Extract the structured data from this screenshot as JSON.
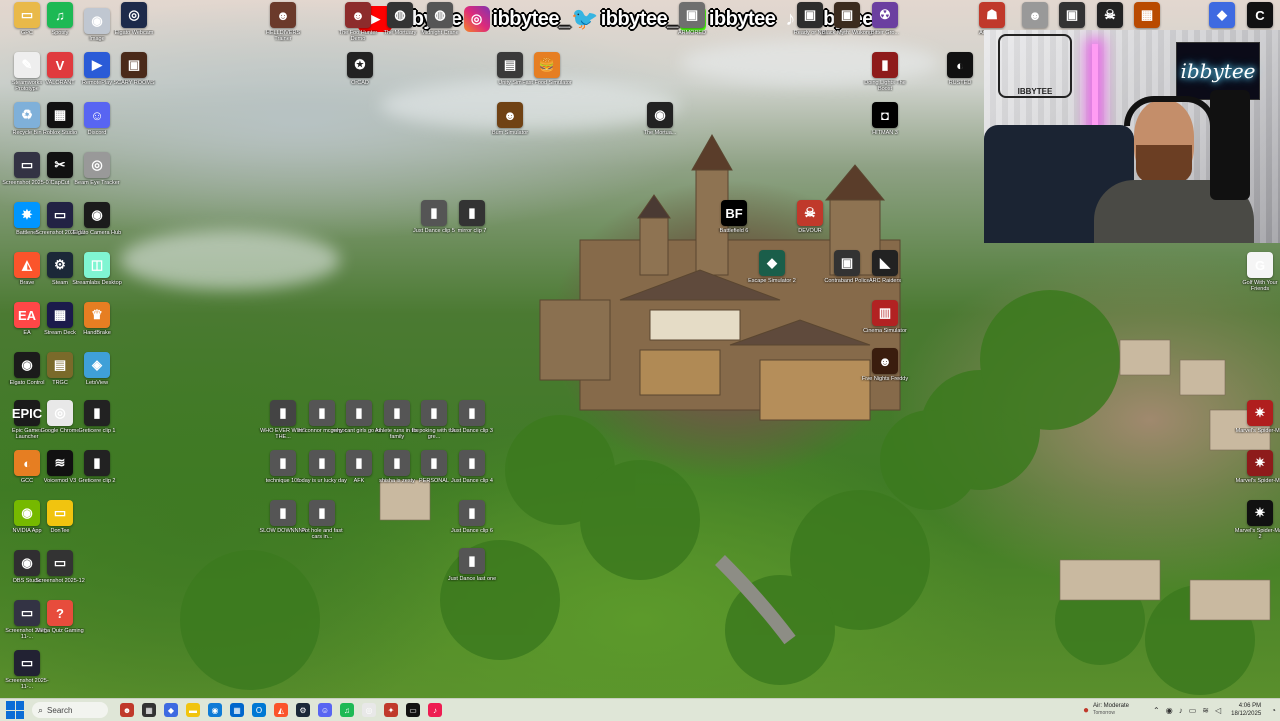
{
  "social": {
    "youtube": "ibbytee",
    "instagram": "ibbytee_",
    "twitter": "ibbytee_",
    "kick": "ibbytee",
    "tiktok": "ibbytee"
  },
  "webcam_overlay": {
    "logo_text": "ibbytee",
    "wall_sign": "IBBYTEE"
  },
  "taskbar": {
    "search_placeholder": "Search",
    "weather_text": "Air: Moderate",
    "weather_sub": "Tomorrow",
    "time": "4:06 PM",
    "date": "18/12/2025"
  },
  "icons": [
    {
      "label": "GPC",
      "color": "#e9b949",
      "glyph": "▭"
    },
    {
      "label": "Spotify",
      "color": "#1db954",
      "glyph": "♫"
    },
    {
      "label": "Image",
      "color": "#c0c7d1",
      "glyph": "◉"
    },
    {
      "label": "Elgato Webcam",
      "color": "#1d2a4a",
      "glyph": "◎"
    },
    {
      "label": "HELLDIVERS Trainer",
      "color": "#6b3a2b",
      "glyph": "☻"
    },
    {
      "label": "The Foo Hunter Demo",
      "color": "#8d2c2c",
      "glyph": "☻"
    },
    {
      "label": "The Mortuary",
      "color": "#333",
      "glyph": "◍"
    },
    {
      "label": "Midnight Crane",
      "color": "#555",
      "glyph": "◍"
    },
    {
      "label": "ARMORED",
      "color": "#6f6f6f",
      "glyph": "▣"
    },
    {
      "label": "Ready or Not",
      "color": "#2d2d2d",
      "glyph": "▣"
    },
    {
      "label": "Black Myth: Wukong",
      "color": "#3b2b1e",
      "glyph": "▣"
    },
    {
      "label": "Bitter Gro...",
      "color": "#6b3fa0",
      "glyph": "☢"
    },
    {
      "label": "Among Us",
      "color": "#c0392b",
      "glyph": "☗"
    },
    {
      "label": "Face",
      "color": "#999",
      "glyph": "☻"
    },
    {
      "label": "Game",
      "color": "#333",
      "glyph": "▣"
    },
    {
      "label": "Game",
      "color": "#222",
      "glyph": "☠"
    },
    {
      "label": "Game",
      "color": "#b94a00",
      "glyph": "▦"
    },
    {
      "label": "Copilot",
      "color": "#3e6ae1",
      "glyph": "◆"
    },
    {
      "label": "CALL OF DUTY",
      "color": "#111",
      "glyph": "C"
    },
    {
      "label": "Steamworks Prototype",
      "color": "#eee",
      "glyph": "✎"
    },
    {
      "label": "VALORANT",
      "color": "#e03a3e",
      "glyph": "V"
    },
    {
      "label": "RemotePlay",
      "color": "#2a5bd7",
      "glyph": "▶"
    },
    {
      "label": "SCARY ROOMS",
      "color": "#4a2a1a",
      "glyph": "▣"
    },
    {
      "label": "OrCAD",
      "color": "#222",
      "glyph": "✪"
    },
    {
      "label": "Unity Sim",
      "color": "#3a3a3a",
      "glyph": "▤"
    },
    {
      "label": "Fast Food Simulator",
      "color": "#e67e22",
      "glyph": "🍔"
    },
    {
      "label": "Doing Lights The Boost",
      "color": "#8e1b1b",
      "glyph": "▮"
    },
    {
      "label": "RUSTED",
      "color": "#111",
      "glyph": "◐"
    },
    {
      "label": "Recycle Bin",
      "color": "#7fb0d9",
      "glyph": "♻"
    },
    {
      "label": "Roblox Studio",
      "color": "#111",
      "glyph": "▦"
    },
    {
      "label": "Discord",
      "color": "#5865f2",
      "glyph": "☺"
    },
    {
      "label": "Bum Simulator",
      "color": "#704214",
      "glyph": "☻"
    },
    {
      "label": "The Mortua...",
      "color": "#222",
      "glyph": "◉"
    },
    {
      "label": "HITMAN 3",
      "color": "#000",
      "glyph": "◘"
    },
    {
      "label": "Screenshot 2025-07",
      "color": "#334",
      "glyph": "▭"
    },
    {
      "label": "CapCut",
      "color": "#111",
      "glyph": "✂"
    },
    {
      "label": "Beam Eye Tracker",
      "color": "#999",
      "glyph": "◎"
    },
    {
      "label": "Battlenet",
      "color": "#0096ff",
      "glyph": "✸"
    },
    {
      "label": "Screenshot 2025-11",
      "color": "#224",
      "glyph": "▭"
    },
    {
      "label": "Elgato Camera Hub",
      "color": "#1b1b1b",
      "glyph": "◉"
    },
    {
      "label": "Just Dance clip 5",
      "color": "#555",
      "glyph": "▮"
    },
    {
      "label": "mirror clip 7",
      "color": "#333",
      "glyph": "▮"
    },
    {
      "label": "Battlefield 6",
      "color": "#000",
      "glyph": "BF"
    },
    {
      "label": "DEVOUR",
      "color": "#c0392b",
      "glyph": "☠"
    },
    {
      "label": "Escape Simulator 2",
      "color": "#1a5e4a",
      "glyph": "◆"
    },
    {
      "label": "Contraband Police",
      "color": "#333",
      "glyph": "▣"
    },
    {
      "label": "ARC Raiders",
      "color": "#222",
      "glyph": "◣"
    },
    {
      "label": "Brave",
      "color": "#fb542b",
      "glyph": "◭"
    },
    {
      "label": "Steam",
      "color": "#1b2838",
      "glyph": "⚙"
    },
    {
      "label": "Streamlabs Desktop",
      "color": "#80f5d2",
      "glyph": "◫"
    },
    {
      "label": "Cinema Simulator",
      "color": "#b22222",
      "glyph": "▥"
    },
    {
      "label": "Golf With Your Friends",
      "color": "#f5f5f5",
      "glyph": "G"
    },
    {
      "label": "EA",
      "color": "#ff4747",
      "glyph": "EA"
    },
    {
      "label": "Stream Deck",
      "color": "#1b1b4b",
      "glyph": "▦"
    },
    {
      "label": "HandBrake",
      "color": "#e67e22",
      "glyph": "♛"
    },
    {
      "label": "Five Nights Freddy",
      "color": "#3a1d0e",
      "glyph": "☻"
    },
    {
      "label": "Elgato Control",
      "color": "#1b1b1b",
      "glyph": "◉"
    },
    {
      "label": "TRGC",
      "color": "#7a6a2a",
      "glyph": "▤"
    },
    {
      "label": "LetsView",
      "color": "#3fa0d8",
      "glyph": "◈"
    },
    {
      "label": "Epic Games Launcher",
      "color": "#1b1b1b",
      "glyph": "EPIC"
    },
    {
      "label": "Google Chrome",
      "color": "#e8e8e8",
      "glyph": "◎"
    },
    {
      "label": "Greticere clip 1",
      "color": "#222",
      "glyph": "▮"
    },
    {
      "label": "WHO EVER WINS THE...",
      "color": "#444",
      "glyph": "▮"
    },
    {
      "label": "im connor mcgregor",
      "color": "#555",
      "glyph": "▮"
    },
    {
      "label": "why cant girls go to...",
      "color": "#555",
      "glyph": "▮"
    },
    {
      "label": "Athlete runs in the family",
      "color": "#555",
      "glyph": "▮"
    },
    {
      "label": "Its poking with the gre...",
      "color": "#555",
      "glyph": "▮"
    },
    {
      "label": "Just Dance clip 3",
      "color": "#555",
      "glyph": "▮"
    },
    {
      "label": "Marvel's Spider-M...",
      "color": "#b01e1e",
      "glyph": "✷"
    },
    {
      "label": "GCC",
      "color": "#e67e22",
      "glyph": "◐"
    },
    {
      "label": "Voicemod V3",
      "color": "#111",
      "glyph": "≋"
    },
    {
      "label": "Greticere clip 2",
      "color": "#222",
      "glyph": "▮"
    },
    {
      "label": "technique 101",
      "color": "#555",
      "glyph": "▮"
    },
    {
      "label": "today is ur lucky day",
      "color": "#555",
      "glyph": "▮"
    },
    {
      "label": "AFK",
      "color": "#555",
      "glyph": "▮"
    },
    {
      "label": "shisha is zesty",
      "color": "#555",
      "glyph": "▮"
    },
    {
      "label": "PERSONAL",
      "color": "#555",
      "glyph": "▮"
    },
    {
      "label": "Just Dance clip 4",
      "color": "#555",
      "glyph": "▮"
    },
    {
      "label": "Marvel's Spider-M...",
      "color": "#8e1b1b",
      "glyph": "✷"
    },
    {
      "label": "NVIDIA App",
      "color": "#76b900",
      "glyph": "◉"
    },
    {
      "label": "DonTee",
      "color": "#f1c40f",
      "glyph": "▭"
    },
    {
      "label": "SLOW DOWNNNN",
      "color": "#555",
      "glyph": "▮"
    },
    {
      "label": "Pot hole and fast cars in...",
      "color": "#555",
      "glyph": "▮"
    },
    {
      "label": "Just Dance clip 6",
      "color": "#555",
      "glyph": "▮"
    },
    {
      "label": "Marvel's Spider-Man 2",
      "color": "#111",
      "glyph": "✷"
    },
    {
      "label": "OBS Studio",
      "color": "#302e31",
      "glyph": "◉"
    },
    {
      "label": "Screenshot 2025-12",
      "color": "#333",
      "glyph": "▭"
    },
    {
      "label": "Just Dance last one",
      "color": "#555",
      "glyph": "▮"
    },
    {
      "label": "Screenshot 2025-11-...",
      "color": "#334",
      "glyph": "▭"
    },
    {
      "label": "Mega Quiz Gaming",
      "color": "#e74c3c",
      "glyph": "?"
    },
    {
      "label": "Screenshot 2025-11-...",
      "color": "#223",
      "glyph": "▭"
    }
  ],
  "taskbar_apps": [
    {
      "name": "people",
      "color": "#c0392b",
      "glyph": "☻"
    },
    {
      "name": "taskview",
      "color": "#333",
      "glyph": "▦"
    },
    {
      "name": "copilot",
      "color": "#3e6ae1",
      "glyph": "◆"
    },
    {
      "name": "explorer",
      "color": "#f1c40f",
      "glyph": "▬"
    },
    {
      "name": "edge",
      "color": "#0f7bd6",
      "glyph": "◉"
    },
    {
      "name": "store",
      "color": "#0066cc",
      "glyph": "▦"
    },
    {
      "name": "outlook",
      "color": "#0078d4",
      "glyph": "O"
    },
    {
      "name": "brave",
      "color": "#fb542b",
      "glyph": "◭"
    },
    {
      "name": "steam",
      "color": "#1b2838",
      "glyph": "⚙"
    },
    {
      "name": "discord",
      "color": "#5865f2",
      "glyph": "☺"
    },
    {
      "name": "spotify",
      "color": "#1db954",
      "glyph": "♫"
    },
    {
      "name": "chrome",
      "color": "#e8e8e8",
      "glyph": "◎"
    },
    {
      "name": "app",
      "color": "#c0392b",
      "glyph": "✦"
    },
    {
      "name": "terminal",
      "color": "#111",
      "glyph": "▭"
    },
    {
      "name": "tiktok",
      "color": "#ee1d52",
      "glyph": "♪"
    }
  ]
}
